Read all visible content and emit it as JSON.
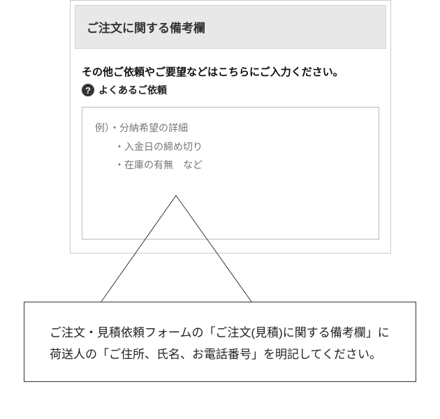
{
  "panel": {
    "heading": "ご注文に関する備考欄",
    "intro": "その他ご依頼やご要望などはこちらにご入力ください。",
    "help_icon_char": "?",
    "help_label": "よくあるご依頼",
    "placeholder": "例）・分納希望の詳細\n　　・入金日の締め切り\n　　・在庫の有無　など"
  },
  "callout": {
    "text": "ご注文・見積依頼フォームの「ご注文(見積)に関する備考欄」に荷送人の「ご住所、氏名、お電話番号」を明記してください。"
  }
}
